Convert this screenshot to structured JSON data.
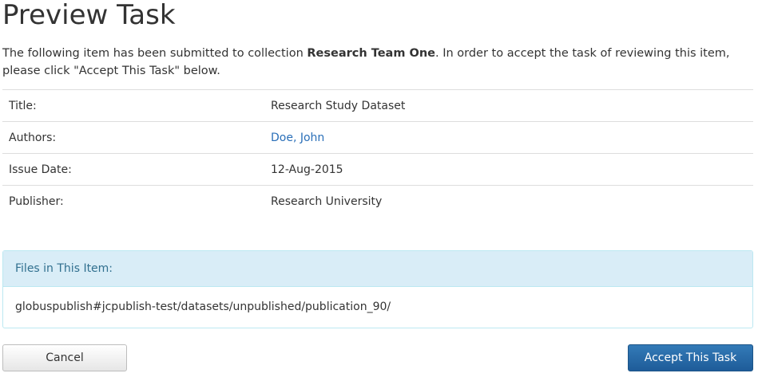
{
  "page": {
    "title": "Preview Task"
  },
  "intro": {
    "text_before": "The following item has been submitted to collection ",
    "collection": "Research Team One",
    "text_after": ". In order to accept the task of reviewing this item, please click \"Accept This Task\" below."
  },
  "metadata": [
    {
      "label": "Title:",
      "value": "Research Study Dataset"
    },
    {
      "label": "Authors:",
      "value": "Doe, John"
    },
    {
      "label": "Issue Date:",
      "value": "12-Aug-2015"
    },
    {
      "label": "Publisher:",
      "value": "Research University"
    }
  ],
  "files": {
    "heading": "Files in This Item:",
    "path": "globuspublish#jcpublish-test/datasets/unpublished/publication_90/"
  },
  "actions": {
    "cancel_label": "Cancel",
    "accept_label": "Accept This Task"
  },
  "colors": {
    "link": "#2a6fb8",
    "panel_heading_bg": "#d9edf7",
    "panel_heading_text": "#31708f",
    "primary_button": "#337ab7"
  }
}
